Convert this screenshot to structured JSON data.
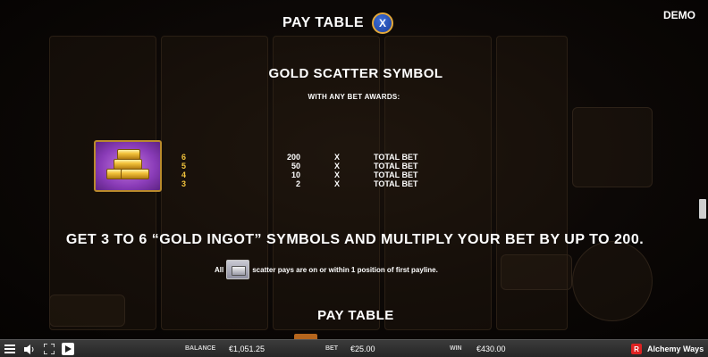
{
  "header": {
    "title": "PAY TABLE",
    "close_label": "X",
    "demo_label": "DEMO"
  },
  "scatter": {
    "title": "GOLD SCATTER SYMBOL",
    "subtitle": "WITH ANY BET AWARDS:",
    "counts": [
      "6",
      "5",
      "4",
      "3"
    ],
    "multipliers": [
      "200",
      "50",
      "10",
      "2"
    ],
    "x_symbol": "X",
    "bet_label": "TOTAL BET",
    "headline": "GET 3 TO 6 “GOLD INGOT” SYMBOLS AND MULTIPLY YOUR BET BY UP TO 200.",
    "note_prefix": "All",
    "note_suffix": "scatter pays are on or within 1 position of first payline."
  },
  "next_section": {
    "title": "PAY TABLE"
  },
  "bottom_bar": {
    "balance_label": "BALANCE",
    "balance_value": "€1,051.25",
    "bet_label": "BET",
    "bet_value": "€25.00",
    "win_label": "WIN",
    "win_value": "€430.00",
    "brand_logo_text": "R",
    "game_name": "Alchemy Ways",
    "icons": [
      "menu-icon",
      "sound-icon",
      "fullscreen-icon",
      "play-icon"
    ]
  },
  "colors": {
    "accent_gold": "#f0c23c",
    "tile_purple": "#8a3cb8",
    "close_blue": "#1a3d9a"
  }
}
